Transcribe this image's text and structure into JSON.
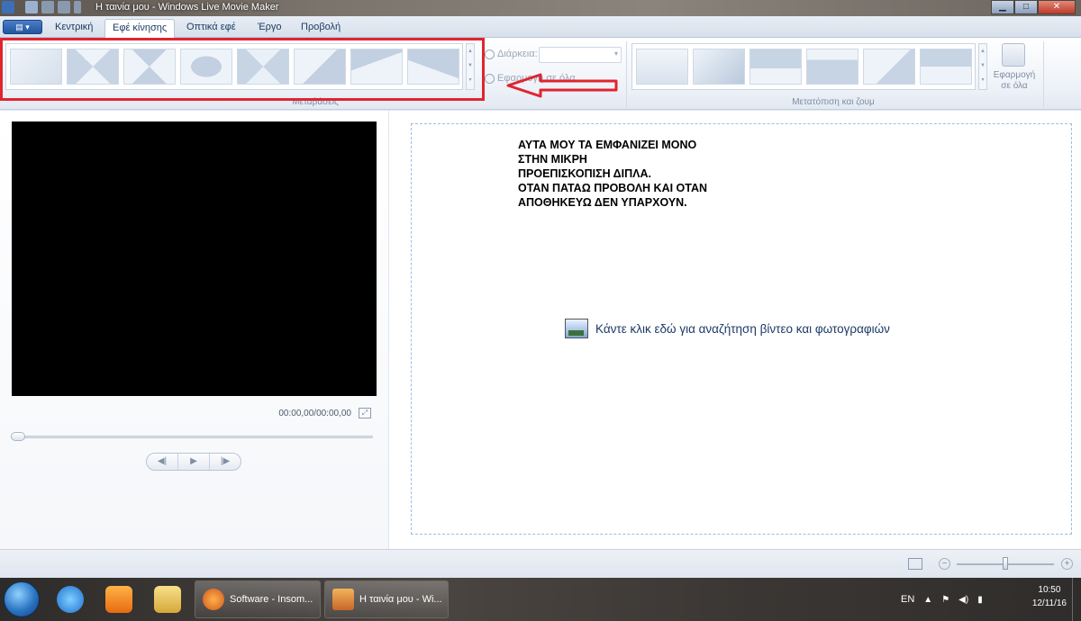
{
  "window": {
    "title": "Η ταινία μου - Windows Live Movie Maker"
  },
  "tabs": [
    {
      "label": "Κεντρική",
      "active": false
    },
    {
      "label": "Εφέ κίνησης",
      "active": true
    },
    {
      "label": "Οπτικά εφέ",
      "active": false
    },
    {
      "label": "Έργο",
      "active": false
    },
    {
      "label": "Προβολή",
      "active": false
    }
  ],
  "ribbon": {
    "transitions_group": {
      "label": "Μεταβάσεις",
      "gallery": [
        "none",
        "cross-fade-x",
        "bow-tie",
        "diamond",
        "diagonal-cross",
        "wipe-diagonal",
        "wipe-v",
        "arrow-left"
      ]
    },
    "duration_label": "Διάρκεια:",
    "apply_to_all_transitions_label": "Εφαρμογή σε όλα",
    "pan_zoom_group": {
      "label": "Μετατόπιση και ζουμ",
      "gallery": [
        "none",
        "auto-sparkle",
        "pan-up",
        "zoom-up",
        "zoom-corner",
        "pan-down"
      ]
    },
    "apply_all_label": "Εφαρμογή σε όλα"
  },
  "preview": {
    "timecode": "00:00,00/00:00,00",
    "transport": {
      "prev": "◀|",
      "play": "▶",
      "next": "|▶"
    }
  },
  "storyboard": {
    "note_lines": [
      "ΑΥΤΑ ΜΟΥ ΤΑ ΕΜΦΑΝΙΖΕΙ ΜΟΝΟ",
      "ΣΤΗΝ ΜΙΚΡΗ",
      "ΠΡΟΕΠΙΣΚΟΠΙΣΗ ΔΙΠΛΑ.",
      "ΟΤΑΝ ΠΑΤΑΩ ΠΡΟΒΟΛΗ ΚΑΙ ΟΤΑΝ",
      "ΑΠΟΘΗΚΕΥΩ ΔΕΝ ΥΠΑΡΧΟΥΝ."
    ],
    "hint": "Κάντε κλικ εδώ για αναζήτηση βίντεο και φωτογραφιών"
  },
  "statusbar": {
    "zoom_level": 0.5
  },
  "taskbar": {
    "buttons": [
      {
        "label": "Software - Insom..."
      },
      {
        "label": "Η ταινία μου - Wi..."
      }
    ],
    "tray": {
      "language": "EN",
      "time": "10:50",
      "date": "12/11/16"
    }
  },
  "colors": {
    "annotation_red": "#e0242f",
    "ribbon_blue": "#21549f"
  }
}
